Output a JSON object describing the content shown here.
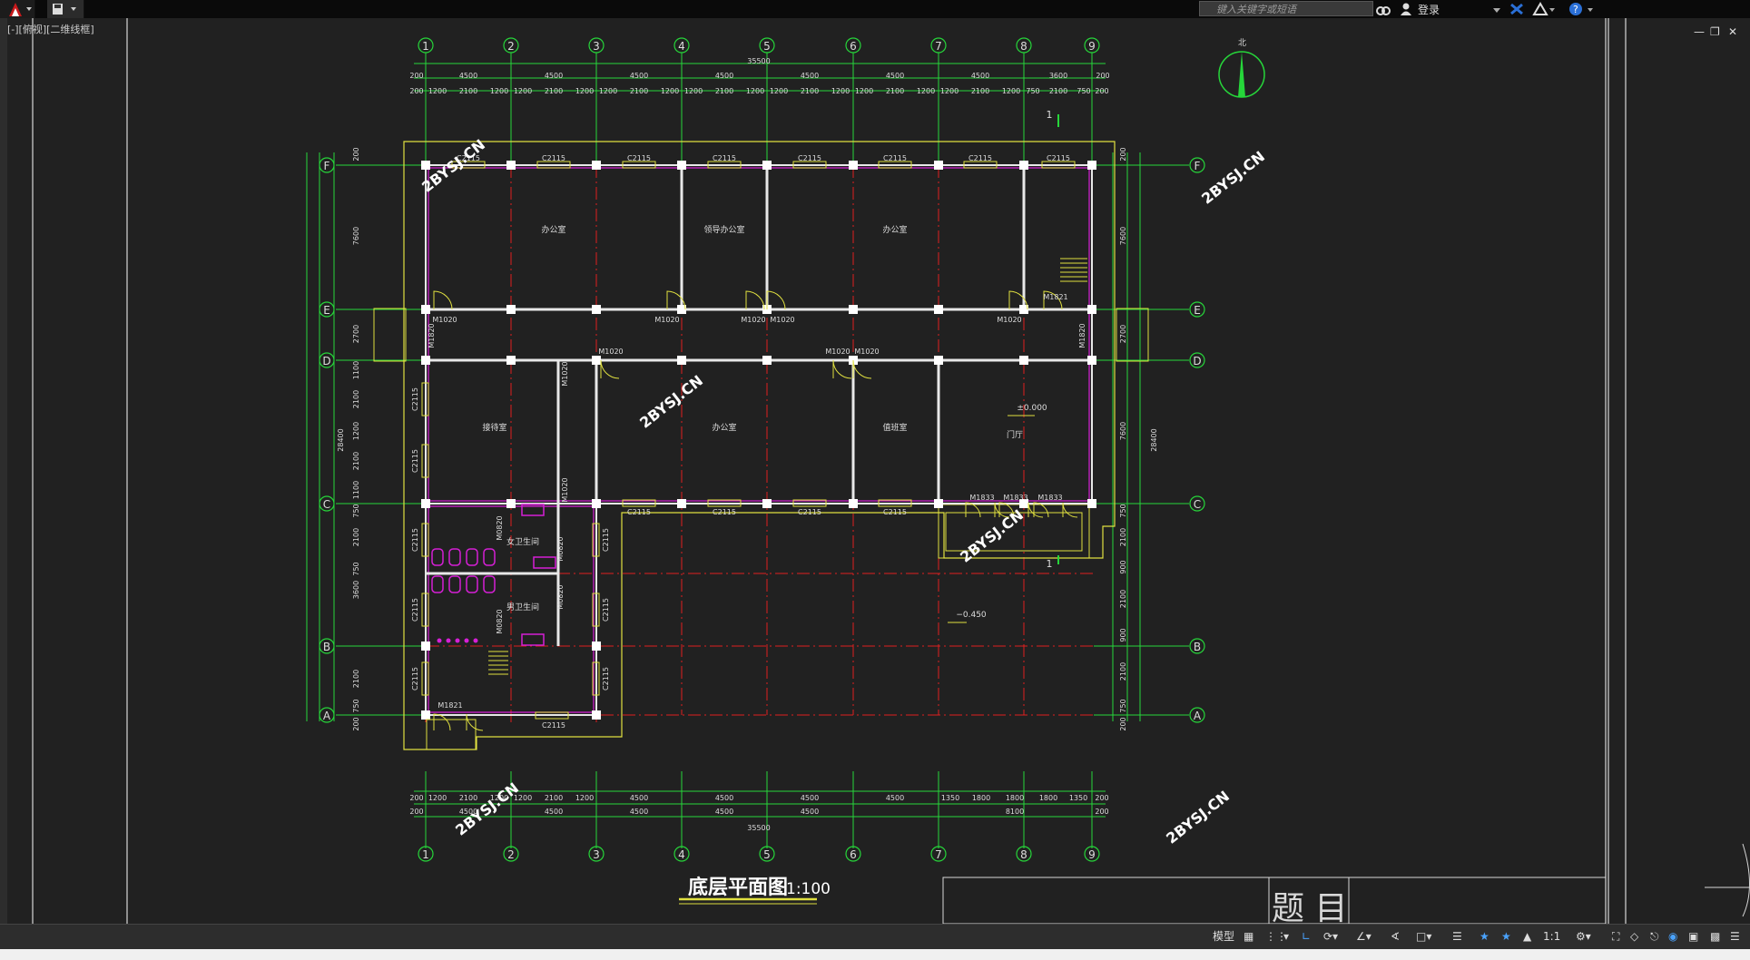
{
  "app": {
    "search_placeholder": "键入关键字或短语",
    "login_label": "登录",
    "view_label": "[-][俯视][二维线框]"
  },
  "drawing": {
    "title": "底层平面图",
    "scale": "1:100",
    "titleblock_label": "题 目",
    "north_label": "北",
    "total_dim": "35500",
    "level_floor": "±0.000",
    "level_outside": "−0.450",
    "section_mark": "1",
    "watermark": "2BYSJ.CN",
    "col_axes": [
      "1",
      "2",
      "3",
      "4",
      "5",
      "6",
      "7",
      "8",
      "9"
    ],
    "row_axes": [
      "F",
      "E",
      "D",
      "C",
      "B",
      "A"
    ],
    "top_dims_outer": [
      "200",
      "4500",
      "4500",
      "4500",
      "4500",
      "4500",
      "4500",
      "4500",
      "3600",
      "200"
    ],
    "top_dims_inner": [
      "200",
      "1200",
      "2100",
      "1200",
      "1200",
      "2100",
      "1200",
      "1200",
      "2100",
      "1200",
      "1200",
      "2100",
      "1200",
      "1200",
      "2100",
      "1200",
      "1200",
      "2100",
      "1200",
      "1200",
      "2100",
      "1200",
      "750",
      "2100",
      "750",
      "200"
    ],
    "bottom_dims_inner": [
      "200",
      "1200",
      "2100",
      "1200",
      "1200",
      "2100",
      "1200",
      "4500",
      "4500",
      "4500",
      "4500",
      "1350",
      "1800",
      "1800",
      "1800",
      "1350",
      "200"
    ],
    "bottom_dims_outer": [
      "200",
      "4500",
      "4500",
      "4500",
      "4500",
      "4500",
      "8100",
      "200"
    ],
    "left_dims": [
      "200",
      "7600",
      "2700",
      "1100",
      "2100",
      "1200",
      "2100",
      "1100",
      "750",
      "2100",
      "750",
      "3600",
      "2100",
      "750",
      "200"
    ],
    "right_dims": [
      "200",
      "7600",
      "2700",
      "7600",
      "750",
      "2100",
      "900",
      "2100",
      "900",
      "2100",
      "750",
      "200"
    ],
    "left_total": "28400",
    "right_total": "28400",
    "rooms": {
      "office1": "办公室",
      "office_leader": "领导办公室",
      "office2": "办公室",
      "reception": "接待室",
      "office3": "办公室",
      "duty": "值班室",
      "lobby": "门厅",
      "wc_f": "女卫生间",
      "wc_m": "男卫生间"
    },
    "windows": {
      "top": [
        "C2115",
        "C2115",
        "C2115",
        "C2115",
        "C2115",
        "C2115",
        "C2115",
        "C2115"
      ],
      "mid": [
        "C2115",
        "C2115",
        "C2115",
        "C2115"
      ],
      "left": [
        "C2115",
        "C2115",
        "C2115",
        "C2115",
        "C2115"
      ],
      "inner_right": [
        "C2115",
        "C2115",
        "C2115"
      ],
      "bottom": "C2115"
    },
    "doors": {
      "row_e": [
        "M1020",
        "M1020",
        "M1020",
        "M1020",
        "M1020",
        "M1821"
      ],
      "row_d": [
        "M1020",
        "M1020",
        "M1020"
      ],
      "left": [
        "M1820",
        "M1020",
        "M1020"
      ],
      "right": "M1820",
      "front": [
        "M1833",
        "M1833",
        "M1833"
      ],
      "wc": [
        "M0820",
        "M0820",
        "M0820",
        "M0820"
      ],
      "bottom": "M1821"
    }
  },
  "status": {
    "model_label": "模型",
    "scale_label": "1:1"
  },
  "colors": {
    "axis": "#26d63a",
    "wall": "#e8e8e8",
    "wall_inner": "#d61fd6",
    "center": "#e02020",
    "window": "#e0e040",
    "dim": "#26d63a",
    "watermark": "#ffffff"
  }
}
